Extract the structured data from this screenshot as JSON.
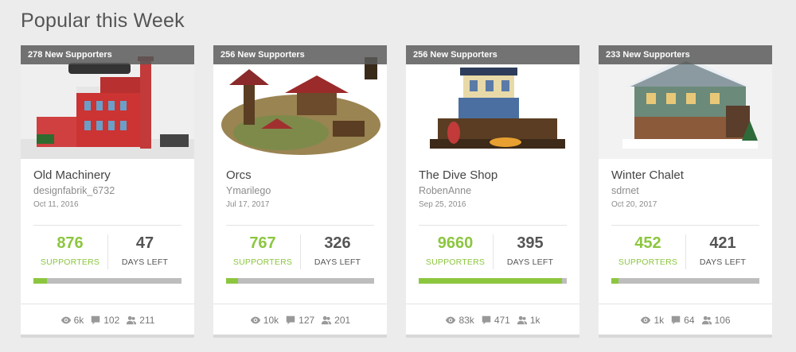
{
  "page": {
    "title": "Popular this Week"
  },
  "labels": {
    "supporters": "SUPPORTERS",
    "days_left": "DAYS LEFT"
  },
  "colors": {
    "accent": "#8cc63f",
    "ribbon": "#5a5a5a",
    "bar_track": "#bdbdbd"
  },
  "cards": [
    {
      "ribbon": "278 New Supporters",
      "title": "Old Machinery",
      "author": "designfabrik_6732",
      "date": "Oct 11, 2016",
      "supporters": "876",
      "days_left": "47",
      "progress_fraction": 0.09,
      "views": "6k",
      "comments": "102",
      "followers": "211",
      "image_icon": "old-machinery-image"
    },
    {
      "ribbon": "256 New Supporters",
      "title": "Orcs",
      "author": "Ymarilego",
      "date": "Jul 17, 2017",
      "supporters": "767",
      "days_left": "326",
      "progress_fraction": 0.08,
      "views": "10k",
      "comments": "127",
      "followers": "201",
      "image_icon": "orcs-image"
    },
    {
      "ribbon": "256 New Supporters",
      "title": "The Dive Shop",
      "author": "RobenAnne",
      "date": "Sep 25, 2016",
      "supporters": "9660",
      "days_left": "395",
      "progress_fraction": 0.97,
      "views": "83k",
      "comments": "471",
      "followers": "1k",
      "image_icon": "dive-shop-image"
    },
    {
      "ribbon": "233 New Supporters",
      "title": "Winter Chalet",
      "author": "sdrnet",
      "date": "Oct 20, 2017",
      "supporters": "452",
      "days_left": "421",
      "progress_fraction": 0.05,
      "views": "1k",
      "comments": "64",
      "followers": "106",
      "image_icon": "winter-chalet-image"
    }
  ]
}
